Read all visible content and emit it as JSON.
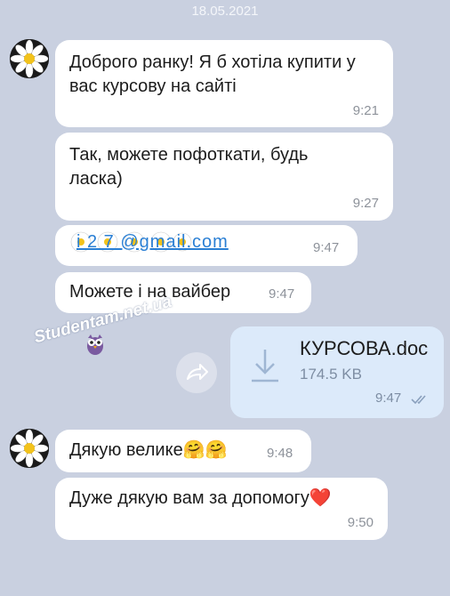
{
  "chat": {
    "date_separator": "18.05.2021",
    "messages": [
      {
        "text": "Доброго ранку! Я б хотіла купити у вас курсову на сайті",
        "time": "9:21"
      },
      {
        "text": "Так, можете пофоткати, будь ласка)",
        "time": "9:27"
      },
      {
        "text": "i 2 7 @gmail.com",
        "time": "9:47"
      },
      {
        "text": "Можете і на вайбер",
        "time": "9:47"
      },
      {
        "text": "Дякую велике🤗🤗",
        "time": "9:48"
      },
      {
        "text": "Дуже дякую вам за допомогу❤️",
        "time": "9:50"
      }
    ],
    "file": {
      "name": "КУРСОВА.doc",
      "size": "174.5 KB",
      "time": "9:47",
      "status_icon": "double-check-icon"
    }
  },
  "watermark": "Studentam.net.ua",
  "colors": {
    "background": "#c9d0e0",
    "incoming_bubble": "#ffffff",
    "outgoing_bubble": "#dceafa",
    "link": "#2a7fd4"
  }
}
